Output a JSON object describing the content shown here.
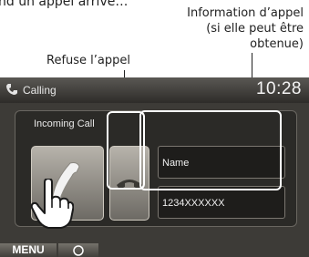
{
  "top_text": "nd un appel arrive…",
  "annotations": {
    "refuse": "Refuse l’appel",
    "info": "Information d’appel\n(si elle peut être\nobtenue)"
  },
  "screen": {
    "title": "Calling",
    "time": "10:28",
    "incoming_label": "Incoming Call",
    "caller_name": "Name",
    "caller_number": "1234XXXXXX",
    "menu_label": "MENU"
  },
  "icons": {
    "status": "phone-handset-icon",
    "accept": "phone-off-hook-icon",
    "refuse": "phone-hang-up-icon",
    "hand": "pointing-hand-icon",
    "home": "home-icon"
  }
}
